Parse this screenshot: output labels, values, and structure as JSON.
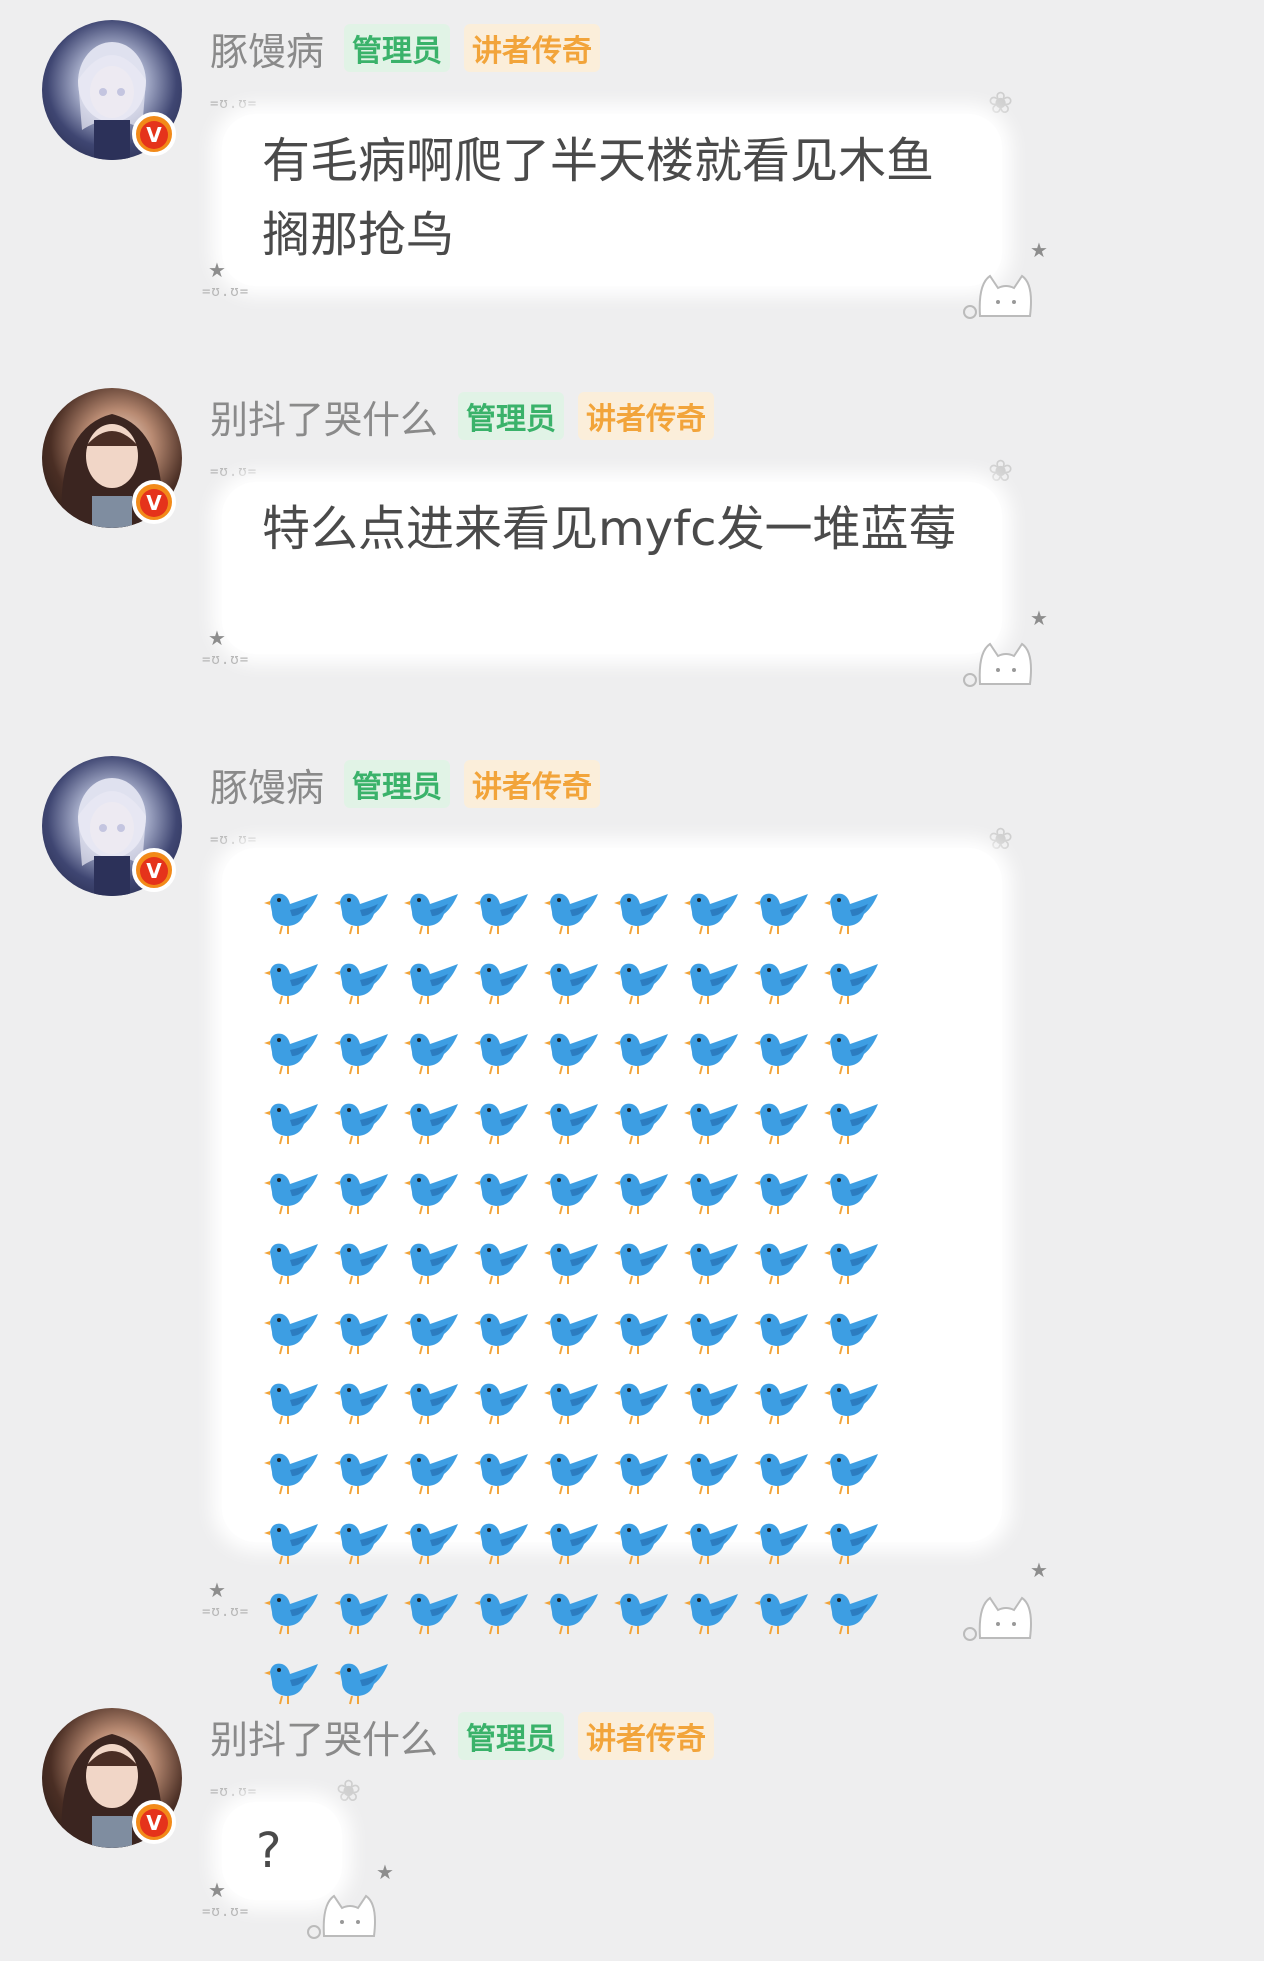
{
  "messages": [
    {
      "user": "豚馒病",
      "badges": [
        "管理员",
        "讲者传奇"
      ],
      "text": "有毛病啊爬了半天楼就看见木鱼搁那抢鸟",
      "avatar": "anime-avatar",
      "kaomoji_top": "=ʊ.ʊ=",
      "kaomoji_bottom": "=ʊ.ʊ="
    },
    {
      "user": "别抖了哭什么",
      "badges": [
        "管理员",
        "讲者传奇"
      ],
      "text": "特么点进来看见myfc发一堆蓝莓",
      "avatar": "photo-avatar",
      "kaomoji_top": "=ʊ.ʊ=",
      "kaomoji_bottom": "=ʊ.ʊ="
    },
    {
      "user": "豚馒病",
      "badges": [
        "管理员",
        "讲者传奇"
      ],
      "bird_count": 101,
      "bird_icon": "blue-bird-emoji",
      "avatar": "anime-avatar",
      "kaomoji_top": "=ʊ.ʊ=",
      "kaomoji_bottom": "=ʊ.ʊ="
    },
    {
      "user": "别抖了哭什么",
      "badges": [
        "管理员",
        "讲者传奇"
      ],
      "text": "?",
      "avatar": "photo-avatar",
      "kaomoji_top": "=ʊ.ʊ=",
      "kaomoji_bottom": "=ʊ.ʊ="
    }
  ],
  "verified_badge": "V",
  "colors": {
    "background": "#eeeeef",
    "admin_tag": "#3ab26a",
    "legend_tag": "#f2a43a",
    "bird": "#3d9ee3"
  }
}
